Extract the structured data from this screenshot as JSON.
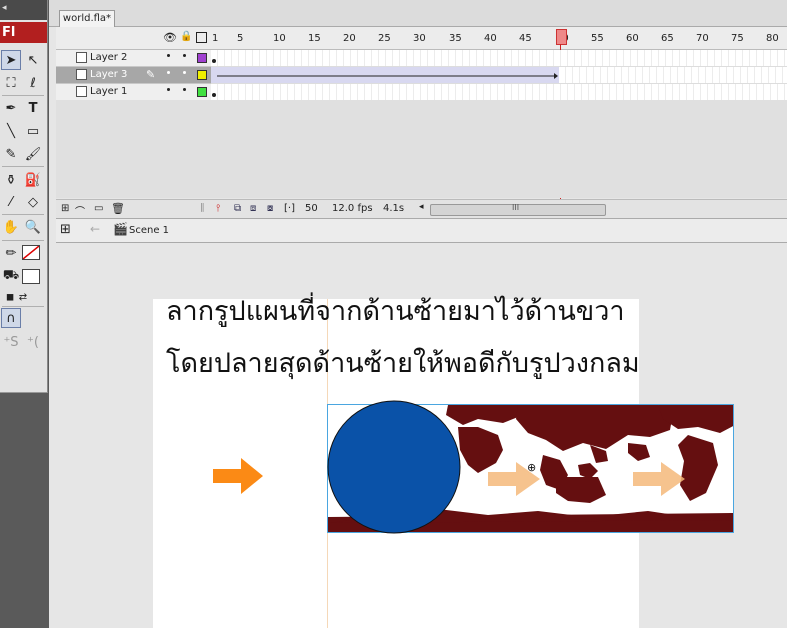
{
  "app": {
    "logo_text": "Fl"
  },
  "document": {
    "tab_title": "world.fla*"
  },
  "timeline": {
    "frame_numbers": [
      "1",
      "5",
      "10",
      "15",
      "20",
      "25",
      "30",
      "35",
      "40",
      "45",
      "50",
      "55",
      "60",
      "65",
      "70",
      "75",
      "80"
    ],
    "current_frame_marker": "50",
    "layers": [
      {
        "name": "Layer 2",
        "color": "#a040d0",
        "selected": false
      },
      {
        "name": "Layer 3",
        "color": "#f0f000",
        "selected": true
      },
      {
        "name": "Layer 1",
        "color": "#40e040",
        "selected": false
      }
    ],
    "footer": {
      "current_frame": "50",
      "fps": "12.0 fps",
      "time": "4.1s",
      "scroll_grip": "III"
    }
  },
  "edit_bar": {
    "scene_label": "Scene 1"
  },
  "stage": {
    "instruction_line1": "ลากรูปแผนที่จากด้านซ้ายมาไว้ด้านขวา",
    "instruction_line2": "โดยปลายสุดด้านซ้ายให้พอดีกับรูปวงกลม",
    "circle_color": "#0a52a8",
    "map_color": "#650f10",
    "arrow_color": "#fb8a15",
    "arrow_light_color": "#f5b87a"
  }
}
